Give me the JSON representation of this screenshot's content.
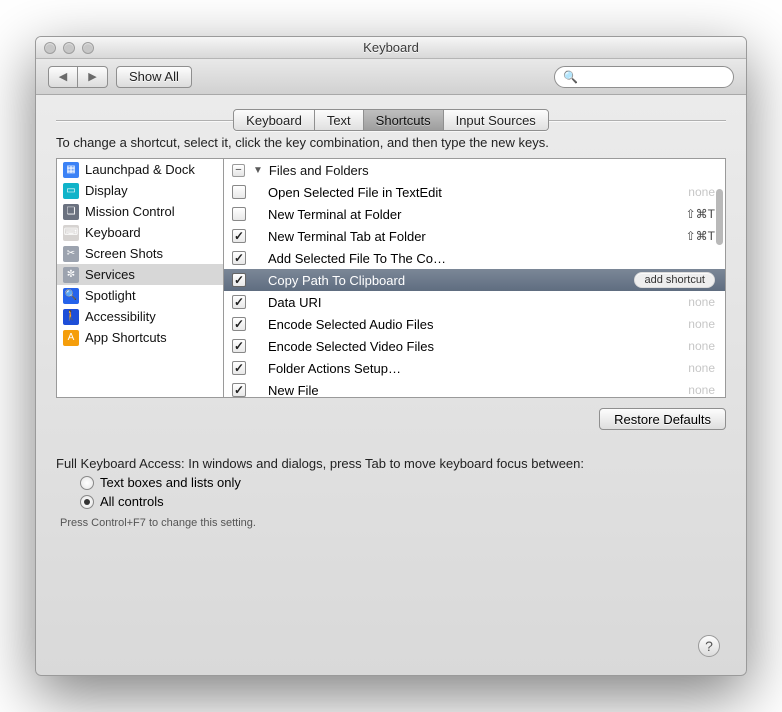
{
  "window": {
    "title": "Keyboard"
  },
  "toolbar": {
    "show_all": "Show All",
    "search_placeholder": ""
  },
  "tabs": {
    "keyboard": "Keyboard",
    "text": "Text",
    "shortcuts": "Shortcuts",
    "input_sources": "Input Sources"
  },
  "body": {
    "instruction": "To change a shortcut, select it, click the key combination, and then type the new keys.",
    "restore_defaults": "Restore Defaults"
  },
  "categories": [
    {
      "label": "Launchpad & Dock",
      "icon_bg": "#3b82f6",
      "glyph": "▦"
    },
    {
      "label": "Display",
      "icon_bg": "#10b3c9",
      "glyph": "▭"
    },
    {
      "label": "Mission Control",
      "icon_bg": "#6b7280",
      "glyph": "❏"
    },
    {
      "label": "Keyboard",
      "icon_bg": "#d6d3d1",
      "glyph": "⌨"
    },
    {
      "label": "Screen Shots",
      "icon_bg": "#9ca3af",
      "glyph": "✂"
    },
    {
      "label": "Services",
      "icon_bg": "#9ca3af",
      "glyph": "✼",
      "selected": true
    },
    {
      "label": "Spotlight",
      "icon_bg": "#2563eb",
      "glyph": "🔍"
    },
    {
      "label": "Accessibility",
      "icon_bg": "#1d4ed8",
      "glyph": "🚶"
    },
    {
      "label": "App Shortcuts",
      "icon_bg": "#f59e0b",
      "glyph": "A"
    }
  ],
  "services": {
    "group_label": "Files and Folders",
    "add_shortcut_label": "add shortcut",
    "items": [
      {
        "name": "Open Selected File in TextEdit",
        "checked": false,
        "shortcut": "",
        "none": true
      },
      {
        "name": "New Terminal at Folder",
        "checked": false,
        "shortcut": "⇧⌘T"
      },
      {
        "name": "New Terminal Tab at Folder",
        "checked": true,
        "shortcut": "⇧⌘T"
      },
      {
        "name": "Add Selected File To The Co…",
        "checked": true,
        "shortcut": ""
      },
      {
        "name": "Copy Path To Clipboard",
        "checked": true,
        "shortcut": "",
        "selected": true
      },
      {
        "name": "Data URI",
        "checked": true,
        "shortcut": "",
        "none": true
      },
      {
        "name": "Encode Selected Audio Files",
        "checked": true,
        "shortcut": "",
        "none": true
      },
      {
        "name": "Encode Selected Video Files",
        "checked": true,
        "shortcut": "",
        "none": true
      },
      {
        "name": "Folder Actions Setup…",
        "checked": true,
        "shortcut": "",
        "none": true
      },
      {
        "name": "New File",
        "checked": true,
        "shortcut": "",
        "none": true
      }
    ]
  },
  "fka": {
    "prompt": "Full Keyboard Access: In windows and dialogs, press Tab to move keyboard focus between:",
    "opt1": "Text boxes and lists only",
    "opt2": "All controls",
    "hint": "Press Control+F7 to change this setting."
  }
}
